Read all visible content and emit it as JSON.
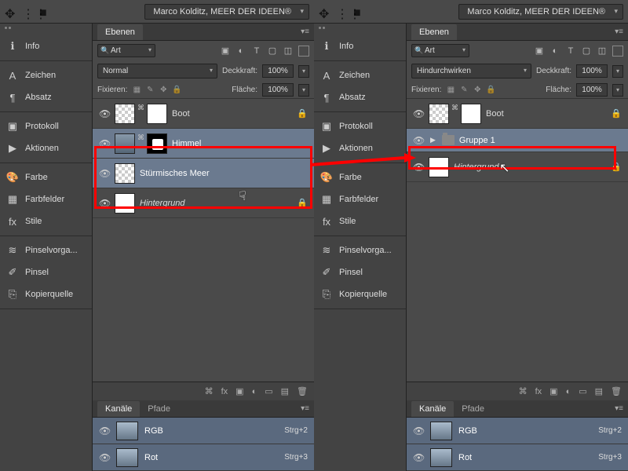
{
  "topbar": {
    "title": "Marco Kolditz, MEER DER IDEEN®"
  },
  "sidebar": {
    "items": [
      {
        "icon": "ℹ",
        "label": "Info"
      },
      {
        "icon": "A",
        "label": "Zeichen"
      },
      {
        "icon": "¶",
        "label": "Absatz"
      },
      {
        "icon": "▣",
        "label": "Protokoll"
      },
      {
        "icon": "▶",
        "label": "Aktionen"
      },
      {
        "icon": "🎨",
        "label": "Farbe"
      },
      {
        "icon": "▦",
        "label": "Farbfelder"
      },
      {
        "icon": "fx",
        "label": "Stile"
      },
      {
        "icon": "≋",
        "label": "Pinselvorga..."
      },
      {
        "icon": "✐",
        "label": "Pinsel"
      },
      {
        "icon": "⎘",
        "label": "Kopierquelle"
      }
    ]
  },
  "panels": {
    "ebenen": "Ebenen",
    "art": "Art",
    "deckkraft": "Deckkraft:",
    "flaeche": "Fläche:",
    "fixieren": "Fixieren:",
    "pct": "100%",
    "kanaele": "Kanäle",
    "pfade": "Pfade"
  },
  "left": {
    "blend": "Normal",
    "layers": [
      {
        "name": "Boot",
        "sel": false,
        "thumbs": [
          "check",
          "mask"
        ],
        "link": true
      },
      {
        "name": "Himmel",
        "sel": true,
        "thumbs": [
          "imgish",
          "maskb"
        ],
        "link": true
      },
      {
        "name": "Stürmisches Meer",
        "sel": true,
        "thumbs": [
          "check"
        ]
      },
      {
        "name": "Hintergrund",
        "sel": false,
        "thumbs": [
          "white"
        ],
        "italic": true,
        "locked": true
      }
    ]
  },
  "right": {
    "blend": "Hindurchwirken",
    "layers": [
      {
        "name": "Boot",
        "thumbs": [
          "check",
          "mask"
        ],
        "link": true
      },
      {
        "name": "Gruppe 1",
        "group": true,
        "sel": true
      },
      {
        "name": "Hintergrund",
        "thumbs": [
          "white"
        ],
        "italic": true,
        "locked": true
      }
    ]
  },
  "channels": [
    {
      "name": "RGB",
      "shortcut": "Strg+2",
      "on": true
    },
    {
      "name": "Rot",
      "shortcut": "Strg+3",
      "on": true
    }
  ]
}
